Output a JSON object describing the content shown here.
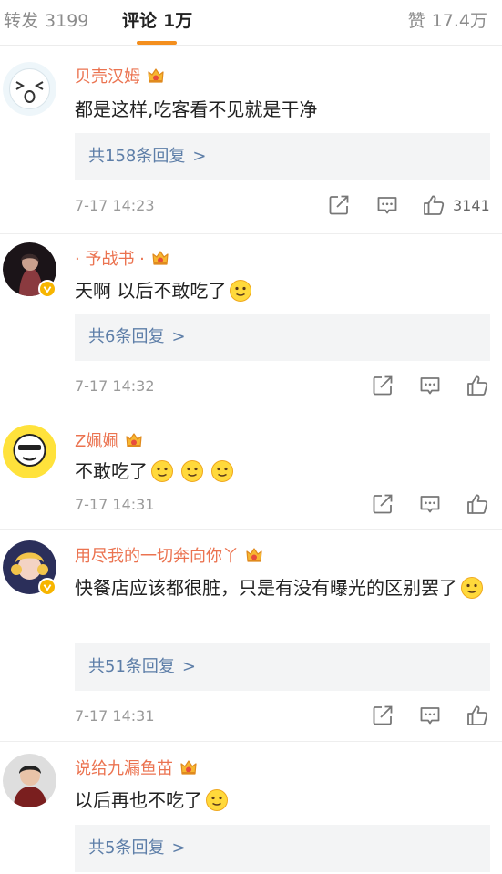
{
  "tabs": {
    "repost": {
      "label": "转发",
      "count": "3199"
    },
    "comments": {
      "label": "评论",
      "count": "1万"
    },
    "likes": {
      "label": "赞",
      "count": "17.4万"
    }
  },
  "colors": {
    "accent": "#f48f1e",
    "username": "#eb7350",
    "reply_link": "#5d7ea8",
    "reply_bg": "#f3f4f5"
  },
  "comments": [
    {
      "username": "贝壳汉姆",
      "text": "都是这样,吃客看不见就是干净",
      "replies": "共158条回复",
      "time": "7-17 14:23",
      "likes": "3141"
    },
    {
      "username": "· 予战书 ·",
      "text": "天啊 以后不敢吃了",
      "replies": "共6条回复",
      "time": "7-17 14:32"
    },
    {
      "username": "Z姵姵",
      "text": "不敢吃了",
      "time": "7-17 14:31"
    },
    {
      "username": "用尽我的一切奔向你丫",
      "text": "快餐店应该都很脏，只是有没有曝光的区别罢了",
      "replies": "共51条回复",
      "time": "7-17 14:31"
    },
    {
      "username": "说给九漏鱼苗",
      "text": "以后再也不吃了",
      "replies": "共5条回复"
    }
  ],
  "reply_arrow": ">",
  "icons": [
    "share-icon",
    "comment-icon",
    "like-icon",
    "crown-badge-icon",
    "verified-badge-icon"
  ]
}
